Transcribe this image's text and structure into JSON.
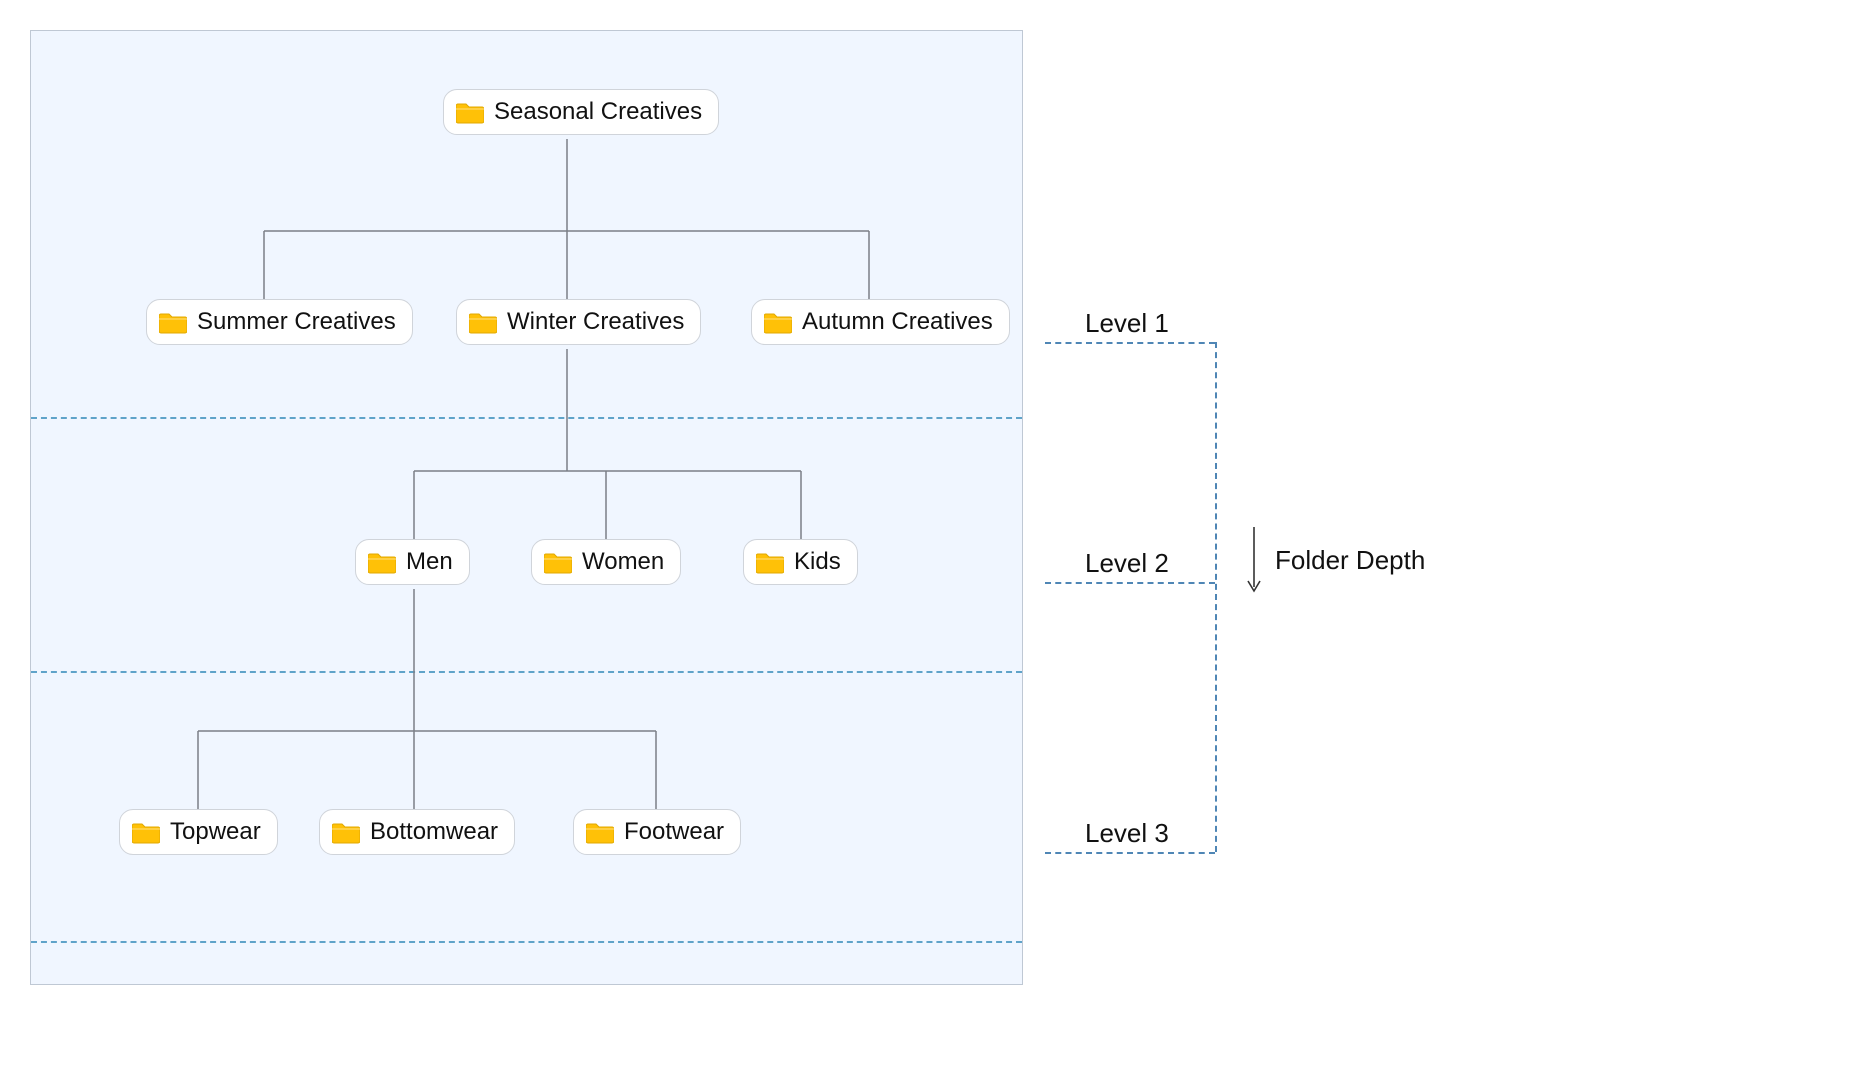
{
  "tree": {
    "root": {
      "label": "Seasonal Creatives"
    },
    "level1": [
      {
        "label": "Summer Creatives"
      },
      {
        "label": "Winter Creatives"
      },
      {
        "label": "Autumn Creatives"
      }
    ],
    "level2": [
      {
        "label": "Men"
      },
      {
        "label": "Women"
      },
      {
        "label": "Kids"
      }
    ],
    "level3": [
      {
        "label": "Topwear"
      },
      {
        "label": "Bottomwear"
      },
      {
        "label": "Footwear"
      }
    ]
  },
  "side": {
    "levels": [
      "Level 1",
      "Level 2",
      "Level 3"
    ],
    "depth_label": "Folder Depth"
  },
  "colors": {
    "panel_bg": "#f0f6ff",
    "panel_border": "#bfc8d4",
    "dash": "#5fa3c9",
    "side_dash": "#4f86b5",
    "connector": "#7a7f87",
    "folder_fill": "#ffc107",
    "folder_stroke": "#e0a800"
  }
}
